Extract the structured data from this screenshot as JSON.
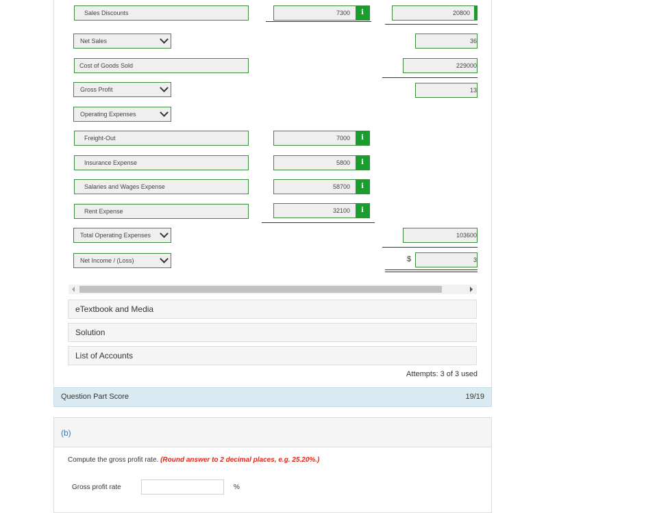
{
  "rows": {
    "sales_discounts": {
      "label": "Sales Discounts",
      "amount": "7300",
      "total": "20800"
    },
    "net_sales": {
      "label": "Net Sales",
      "total": "36"
    },
    "cogs": {
      "label": "Cost of Goods Sold",
      "total": "229000"
    },
    "gross_profit": {
      "label": "Gross Profit",
      "total": "13"
    },
    "operating_expenses": {
      "label": "Operating Expenses"
    },
    "freight_out": {
      "label": "Freight-Out",
      "amount": "7000"
    },
    "insurance": {
      "label": "Insurance Expense",
      "amount": "5800"
    },
    "salaries": {
      "label": "Salaries and Wages Expense",
      "amount": "58700"
    },
    "rent": {
      "label": "Rent Expense",
      "amount": "32100"
    },
    "total_opex": {
      "label": "Total Operating Expenses",
      "total": "103600"
    },
    "net_income": {
      "label": "Net Income / (Loss)",
      "currency": "$",
      "total": "3"
    }
  },
  "info_glyph": "i",
  "accordions": {
    "etextbook": "eTextbook and Media",
    "solution": "Solution",
    "accounts": "List of Accounts"
  },
  "attempts": "Attempts: 3 of 3 used",
  "question_part_score": {
    "label": "Question Part Score",
    "score": "19/19"
  },
  "part_b": {
    "label": "(b)",
    "prompt": "Compute the gross profit rate.",
    "prompt_hint": "(Round answer to 2 decimal places, e.g. 25.20%.)",
    "input_label": "Gross profit rate",
    "input_value": "",
    "unit": "%"
  },
  "colors": {
    "field_border": "#3c8a3c",
    "info_green": "#1a9c2e",
    "score_bar": "#daeaf2",
    "hint_red": "#e0261a",
    "part_link": "#3b73a8"
  }
}
